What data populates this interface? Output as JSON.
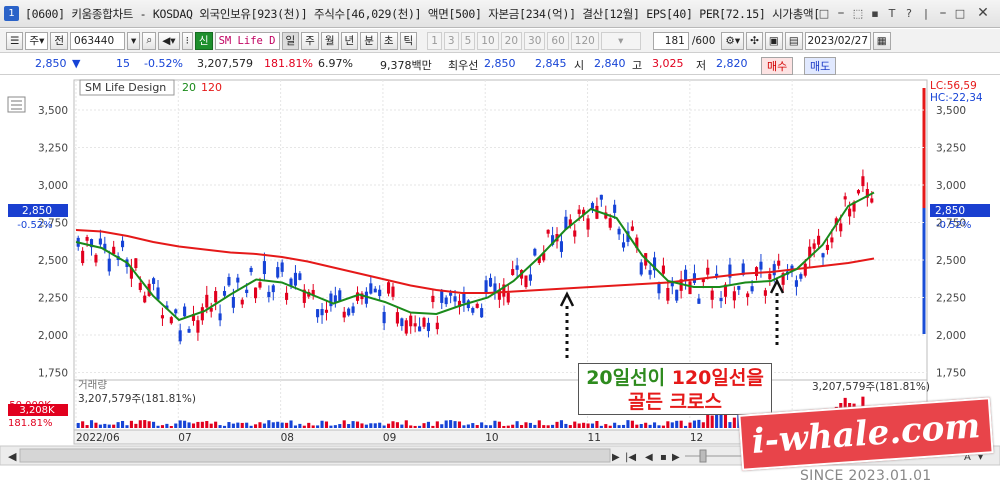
{
  "window": {
    "icon": "1",
    "title": "[0600] 키움종합차트 - KOSDAQ 외국인보유[923(천)] 주식수[46,029(천)] 액면[500] 자본금[234(억)] 결산[12월] EPS[40] PER[72.15] 시가총액[",
    "controls": [
      "□",
      "⎯",
      "⬚",
      "▪",
      "T",
      "?",
      "|",
      "⎯",
      "□",
      "✕"
    ]
  },
  "toolbar": {
    "market_label": "주",
    "all_label": "전",
    "stock_code": "063440",
    "indicator_badge": "신",
    "indicator_name": "SM Life D",
    "period_buttons": [
      "일",
      "주",
      "월",
      "년",
      "분",
      "초",
      "틱"
    ],
    "interval_buttons": [
      "1",
      "3",
      "5",
      "10",
      "20",
      "30",
      "60",
      "120"
    ],
    "count_display": "181",
    "count_total": "/600",
    "date": "2023/02/27"
  },
  "quote": {
    "price": "2,850",
    "change": "15",
    "change_pct": "-0.52%",
    "volume": "3,207,579",
    "volume_ratio": "181.81%",
    "turnover": "6.97%",
    "amount": "9,378백만",
    "best_label": "최우선",
    "best_ask": "2,850",
    "best_bid": "2,845",
    "open_label": "시",
    "open": "2,840",
    "high_label": "고",
    "high": "3,025",
    "low_label": "저",
    "low": "2,820",
    "buy_button": "매수",
    "sell_button": "매도"
  },
  "legend": {
    "name": "SM Life Design",
    "ma_short": "20",
    "ma_long": "120",
    "lc": "LC:56,59",
    "hc": "HC:-22,34",
    "volume_title": "거래량",
    "volume_value": "3,207,579주(181.81%)",
    "volume_right": "3,207,579주(181.81%)",
    "price_tag": "2,850",
    "pct_tag": "-0.52%",
    "vol_tag": "3,208K",
    "vol_pct_tag": "181.81%",
    "vol_axis_hint": "50,000K"
  },
  "colors": {
    "up": "#e1001e",
    "down": "#1643d6",
    "ma20": "#1a8a1a",
    "ma120": "#e51919"
  },
  "chart_data": {
    "type": "line",
    "title": "SM Life Design",
    "xlabel": "",
    "ylabel": "",
    "ylim": [
      1700,
      3700
    ],
    "x": [
      "2022/06",
      "07",
      "08",
      "09",
      "10",
      "11",
      "12",
      "2023/01"
    ],
    "yticks": [
      "3,500",
      "3,250",
      "3,000",
      "2,750",
      "2,500",
      "2,250",
      "2,000",
      "1,750"
    ],
    "series": [
      {
        "name": "20",
        "values": [
          2620,
          2580,
          2480,
          2260,
          2100,
          2160,
          2270,
          2370,
          2350,
          2280,
          2210,
          2270,
          2220,
          2150,
          2140,
          2200,
          2250,
          2360,
          2520,
          2700,
          2840,
          2780,
          2530,
          2360,
          2320,
          2320,
          2350,
          2360,
          2440,
          2600,
          2860,
          2950
        ]
      },
      {
        "name": "120",
        "values": [
          2700,
          2690,
          2660,
          2620,
          2590,
          2570,
          2550,
          2540,
          2520,
          2490,
          2450,
          2410,
          2370,
          2330,
          2300,
          2280,
          2280,
          2290,
          2300,
          2310,
          2320,
          2330,
          2340,
          2350,
          2370,
          2390,
          2410,
          2420,
          2440,
          2460,
          2480,
          2510
        ]
      }
    ]
  },
  "annotation": {
    "line1_green": "20일선",
    "line1_mid": "이 ",
    "line1_red": "120일선",
    "line1_end": "을",
    "line2": "골든 크로스"
  },
  "watermark": {
    "brand": "i-whale.com",
    "since": "SINCE 2023.01.01"
  }
}
